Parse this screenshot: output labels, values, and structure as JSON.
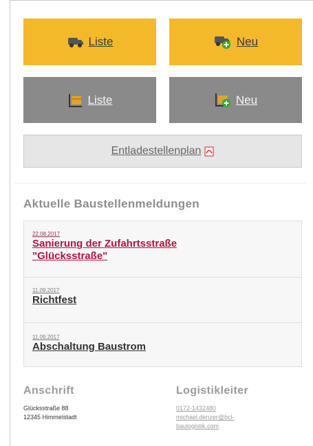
{
  "tiles": {
    "truck_list": "Liste",
    "truck_new": "Neu",
    "package_list": "Liste",
    "package_new": "Neu"
  },
  "plan_button": "Entladestellenplan",
  "news": {
    "heading": "Aktuelle Baustellenmeldungen",
    "items": [
      {
        "date": "22.08.2017",
        "title_line1": "Sanierung der Zufahrtsstraße",
        "title_line2": "\"Glücksstraße\""
      },
      {
        "date": "11.09.2017",
        "title_line1": "Richtfest"
      },
      {
        "date": "11.09.2017",
        "title_line1": "Abschaltung Baustrom"
      }
    ]
  },
  "address": {
    "heading": "Anschrift",
    "street": "Glücksstraße 88",
    "city": "12345 Himmelstadt"
  },
  "logistics": {
    "heading": "Logistikleiter",
    "phone": "0172-1432480",
    "email_line1": "michael.denzer@bcl-",
    "email_line2": "baulogistik.com"
  },
  "colors": {
    "yellow": "#f3b92a",
    "gray": "#8a8a8a",
    "news_accent": "#b3123f"
  },
  "icons": [
    "truck-icon",
    "truck-add-icon",
    "package-icon",
    "package-add-icon",
    "pdf-icon"
  ]
}
